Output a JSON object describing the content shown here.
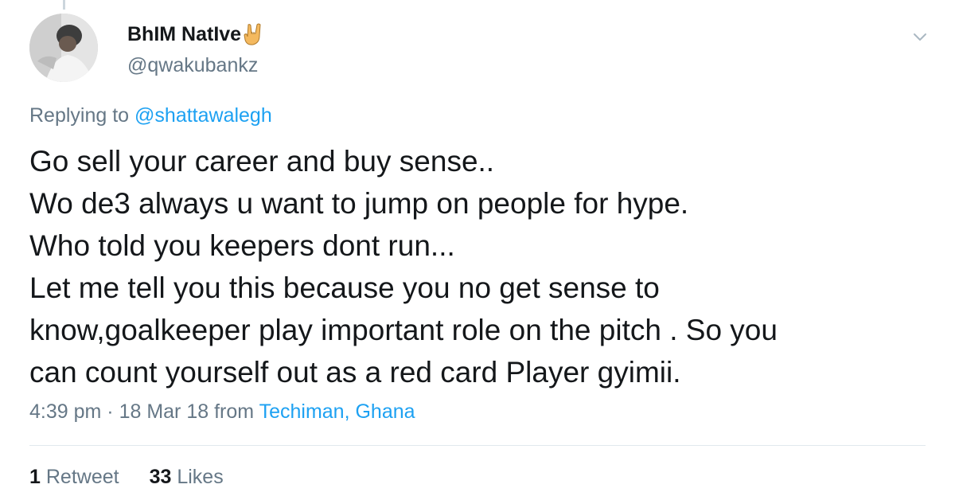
{
  "author": {
    "display_name": "BhIM NatIve",
    "emoji": "sign-of-the-horns-emoji",
    "handle": "@qwakubankz"
  },
  "reply": {
    "prefix": "Replying to",
    "mention": "@shattawalegh"
  },
  "tweet": {
    "lines": [
      "Go sell your career and buy sense..",
      "Wo de3 always u want to jump on people for hype.",
      "Who told you keepers dont run...",
      "Let me tell you this because you no get sense to",
      "know,goalkeeper play important role on the pitch . So you",
      "can count yourself out as a red card Player gyimii."
    ]
  },
  "meta": {
    "time": "4:39 pm",
    "separator": "·",
    "date": "18 Mar 18",
    "from": "from",
    "location": "Techiman, Ghana"
  },
  "stats": {
    "retweets_count": "1",
    "retweets_label": "Retweet",
    "likes_count": "33",
    "likes_label": "Likes"
  },
  "colors": {
    "text": "#14171a",
    "secondary": "#657786",
    "link": "#1da1f2",
    "divider": "#e1e8ed"
  },
  "icons": {
    "menu": "chevron-down-icon"
  }
}
